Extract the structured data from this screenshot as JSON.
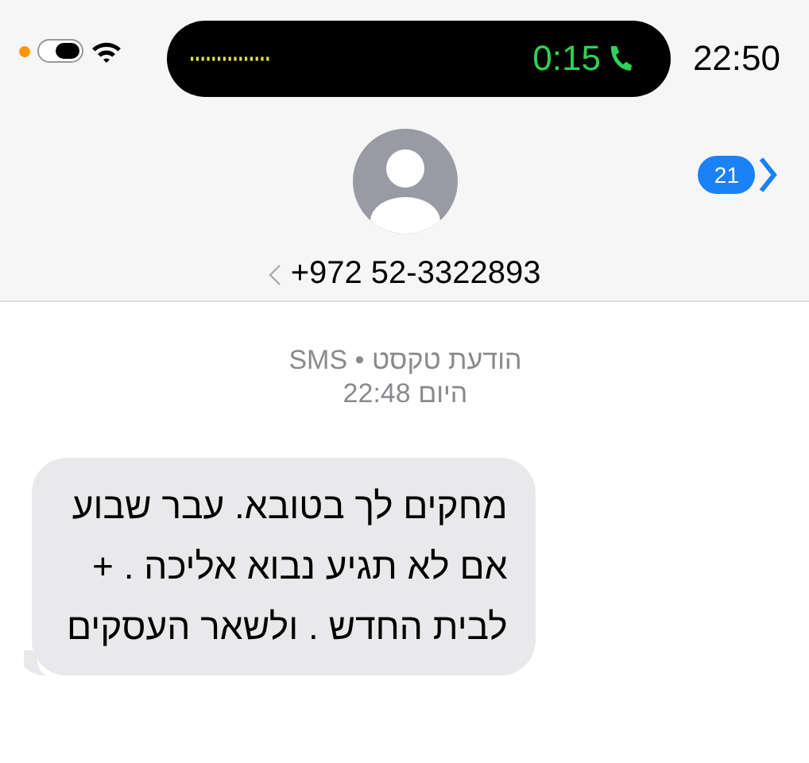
{
  "status_bar": {
    "call_timer": "0:15",
    "time": "22:50"
  },
  "header": {
    "badge": "21",
    "contact": "+972 52-3322893"
  },
  "message_meta": {
    "service": "הודעת טקסט • SMS",
    "timestamp": "היום 22:48"
  },
  "messages": [
    {
      "lines": [
        "מחקים לך בטובא. עבר שבוע",
        "אם לא תגיע נבוא אליכה . +",
        "לבית החדש . ולשאר העסקים"
      ]
    }
  ]
}
